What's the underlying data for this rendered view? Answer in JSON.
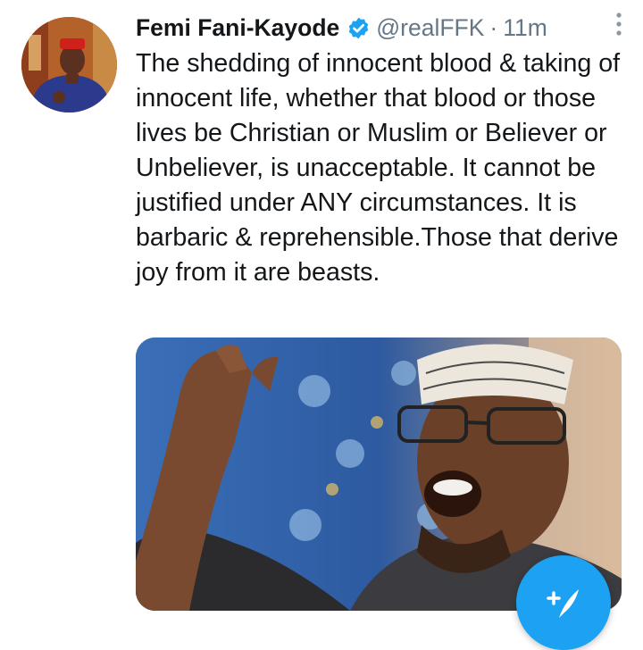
{
  "tweet": {
    "author_name": "Femi Fani-Kayode",
    "handle": "@realFFK",
    "separator": "·",
    "time": "11m",
    "text": "The shedding of innocent blood & taking of innocent life, whether that blood or those lives be Christian or Muslim or Believer or Unbeliever, is unacceptable. It cannot be justified under ANY circumstances. It is barbaric & reprehensible.Those that derive joy from it are beasts."
  },
  "icons": {
    "verified": "verified-badge-icon",
    "more": "more-vertical-icon",
    "compose": "compose-tweet-icon"
  },
  "colors": {
    "accent": "#1da1f2",
    "text": "#14171a",
    "muted": "#657786"
  }
}
